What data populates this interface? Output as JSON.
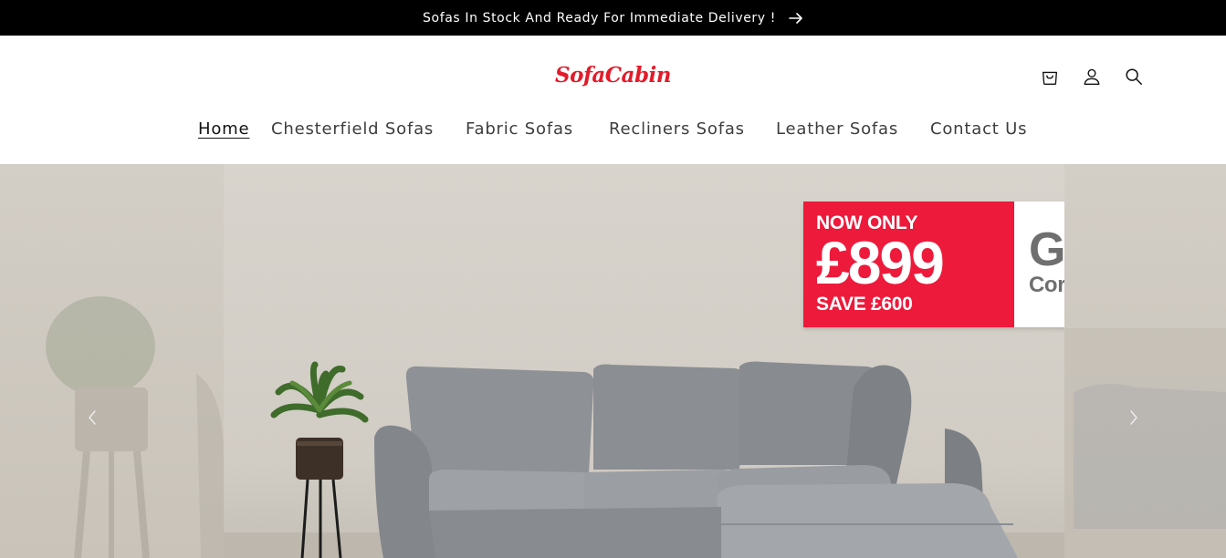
{
  "announcement": {
    "text": "Sofas In Stock And Ready For Immediate Delivery !",
    "icon": "arrow-right-icon"
  },
  "header": {
    "logo": "SofaCabin",
    "brand_color": "#e31b2a",
    "icons": [
      "cart-icon",
      "account-icon",
      "search-icon"
    ]
  },
  "nav": {
    "items": [
      {
        "label": "Home",
        "active": true
      },
      {
        "label": "Chesterfield Sofas",
        "active": false
      },
      {
        "label": "Fabric Sofas",
        "active": false
      },
      {
        "label": "Recliners Sofas",
        "active": false
      },
      {
        "label": "Leather Sofas",
        "active": false
      },
      {
        "label": "Contact Us",
        "active": false
      }
    ]
  },
  "hero": {
    "promo": {
      "now_only": "NOW ONLY",
      "price": "£899",
      "save": "SAVE £600",
      "product_name": "GARDA",
      "product_type": "Corner sofa",
      "accent_color": "#ed1a3b"
    },
    "prev_icon": "chevron-left-icon",
    "next_icon": "chevron-right-icon"
  }
}
